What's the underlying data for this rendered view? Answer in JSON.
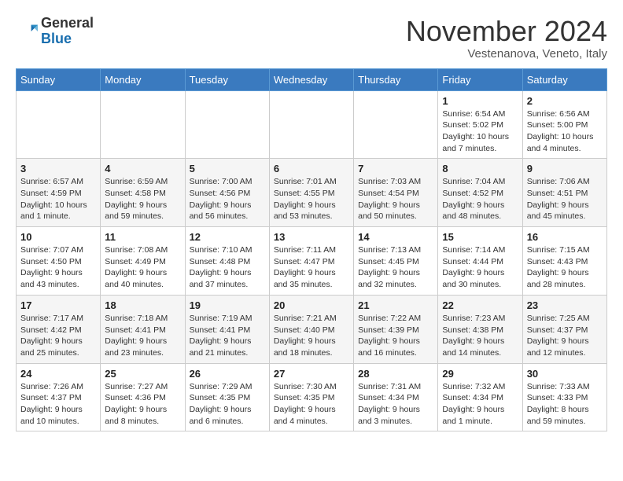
{
  "logo": {
    "general": "General",
    "blue": "Blue"
  },
  "title": "November 2024",
  "subtitle": "Vestenanova, Veneto, Italy",
  "days_header": [
    "Sunday",
    "Monday",
    "Tuesday",
    "Wednesday",
    "Thursday",
    "Friday",
    "Saturday"
  ],
  "weeks": [
    [
      {
        "day": "",
        "info": ""
      },
      {
        "day": "",
        "info": ""
      },
      {
        "day": "",
        "info": ""
      },
      {
        "day": "",
        "info": ""
      },
      {
        "day": "",
        "info": ""
      },
      {
        "day": "1",
        "info": "Sunrise: 6:54 AM\nSunset: 5:02 PM\nDaylight: 10 hours and 7 minutes."
      },
      {
        "day": "2",
        "info": "Sunrise: 6:56 AM\nSunset: 5:00 PM\nDaylight: 10 hours and 4 minutes."
      }
    ],
    [
      {
        "day": "3",
        "info": "Sunrise: 6:57 AM\nSunset: 4:59 PM\nDaylight: 10 hours and 1 minute."
      },
      {
        "day": "4",
        "info": "Sunrise: 6:59 AM\nSunset: 4:58 PM\nDaylight: 9 hours and 59 minutes."
      },
      {
        "day": "5",
        "info": "Sunrise: 7:00 AM\nSunset: 4:56 PM\nDaylight: 9 hours and 56 minutes."
      },
      {
        "day": "6",
        "info": "Sunrise: 7:01 AM\nSunset: 4:55 PM\nDaylight: 9 hours and 53 minutes."
      },
      {
        "day": "7",
        "info": "Sunrise: 7:03 AM\nSunset: 4:54 PM\nDaylight: 9 hours and 50 minutes."
      },
      {
        "day": "8",
        "info": "Sunrise: 7:04 AM\nSunset: 4:52 PM\nDaylight: 9 hours and 48 minutes."
      },
      {
        "day": "9",
        "info": "Sunrise: 7:06 AM\nSunset: 4:51 PM\nDaylight: 9 hours and 45 minutes."
      }
    ],
    [
      {
        "day": "10",
        "info": "Sunrise: 7:07 AM\nSunset: 4:50 PM\nDaylight: 9 hours and 43 minutes."
      },
      {
        "day": "11",
        "info": "Sunrise: 7:08 AM\nSunset: 4:49 PM\nDaylight: 9 hours and 40 minutes."
      },
      {
        "day": "12",
        "info": "Sunrise: 7:10 AM\nSunset: 4:48 PM\nDaylight: 9 hours and 37 minutes."
      },
      {
        "day": "13",
        "info": "Sunrise: 7:11 AM\nSunset: 4:47 PM\nDaylight: 9 hours and 35 minutes."
      },
      {
        "day": "14",
        "info": "Sunrise: 7:13 AM\nSunset: 4:45 PM\nDaylight: 9 hours and 32 minutes."
      },
      {
        "day": "15",
        "info": "Sunrise: 7:14 AM\nSunset: 4:44 PM\nDaylight: 9 hours and 30 minutes."
      },
      {
        "day": "16",
        "info": "Sunrise: 7:15 AM\nSunset: 4:43 PM\nDaylight: 9 hours and 28 minutes."
      }
    ],
    [
      {
        "day": "17",
        "info": "Sunrise: 7:17 AM\nSunset: 4:42 PM\nDaylight: 9 hours and 25 minutes."
      },
      {
        "day": "18",
        "info": "Sunrise: 7:18 AM\nSunset: 4:41 PM\nDaylight: 9 hours and 23 minutes."
      },
      {
        "day": "19",
        "info": "Sunrise: 7:19 AM\nSunset: 4:41 PM\nDaylight: 9 hours and 21 minutes."
      },
      {
        "day": "20",
        "info": "Sunrise: 7:21 AM\nSunset: 4:40 PM\nDaylight: 9 hours and 18 minutes."
      },
      {
        "day": "21",
        "info": "Sunrise: 7:22 AM\nSunset: 4:39 PM\nDaylight: 9 hours and 16 minutes."
      },
      {
        "day": "22",
        "info": "Sunrise: 7:23 AM\nSunset: 4:38 PM\nDaylight: 9 hours and 14 minutes."
      },
      {
        "day": "23",
        "info": "Sunrise: 7:25 AM\nSunset: 4:37 PM\nDaylight: 9 hours and 12 minutes."
      }
    ],
    [
      {
        "day": "24",
        "info": "Sunrise: 7:26 AM\nSunset: 4:37 PM\nDaylight: 9 hours and 10 minutes."
      },
      {
        "day": "25",
        "info": "Sunrise: 7:27 AM\nSunset: 4:36 PM\nDaylight: 9 hours and 8 minutes."
      },
      {
        "day": "26",
        "info": "Sunrise: 7:29 AM\nSunset: 4:35 PM\nDaylight: 9 hours and 6 minutes."
      },
      {
        "day": "27",
        "info": "Sunrise: 7:30 AM\nSunset: 4:35 PM\nDaylight: 9 hours and 4 minutes."
      },
      {
        "day": "28",
        "info": "Sunrise: 7:31 AM\nSunset: 4:34 PM\nDaylight: 9 hours and 3 minutes."
      },
      {
        "day": "29",
        "info": "Sunrise: 7:32 AM\nSunset: 4:34 PM\nDaylight: 9 hours and 1 minute."
      },
      {
        "day": "30",
        "info": "Sunrise: 7:33 AM\nSunset: 4:33 PM\nDaylight: 8 hours and 59 minutes."
      }
    ]
  ]
}
